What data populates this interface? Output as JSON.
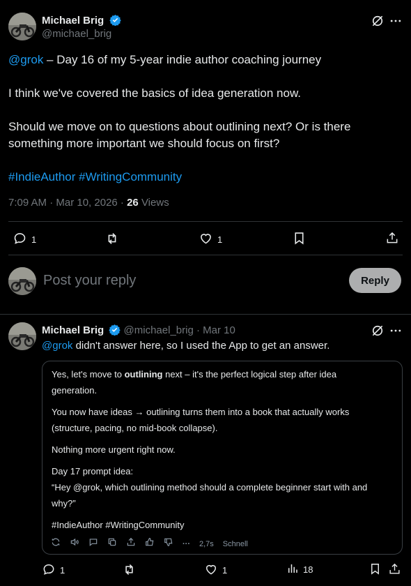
{
  "main_post": {
    "author_name": "Michael Brig",
    "author_handle": "@michael_brig",
    "text_mention": "@grok",
    "text_line1_rest": " – Day 16 of my 5-year indie author coaching journey",
    "text_line2": "I think we've covered the basics of idea generation now.",
    "text_line3a": "Should we move on to questions about outlining next? Or is there",
    "text_line3b": "something more important we should focus on first?",
    "hashtags": "#IndieAuthor #WritingCommunity",
    "timestamp": "7:09 AM · Mar 10, 2026 · ",
    "views_count": "26",
    "views_label": " Views",
    "reply_count": "1",
    "like_count": "1"
  },
  "composer": {
    "placeholder": "Post your reply",
    "reply_label": "Reply"
  },
  "reply_post": {
    "author_name": "Michael Brig",
    "author_handle": "@michael_brig",
    "dot": "·",
    "date": "Mar 10",
    "mention": "@grok",
    "text_rest": " didn't answer here, so I used the App to get an answer.",
    "reply_count": "1",
    "like_count": "1",
    "views_count": "18"
  },
  "grok_card": {
    "p1_pre": "Yes, let's move to ",
    "p1_bold": "outlining",
    "p1_post": " next – it's the perfect logical step after idea",
    "p1_line2": "generation.",
    "p2_line1": "You now have ideas → outlining turns them into a book that actually works",
    "p2_line2": "(structure, pacing, no mid-book collapse).",
    "p3": "Nothing more urgent right now.",
    "p4_line1": "Day 17 prompt idea:",
    "p4_line2": "“Hey @grok, which outlining method should a complete beginner start with and",
    "p4_line3": "why?”",
    "p5": "#IndieAuthor #WritingCommunity",
    "ellipsis": "···",
    "time": "2,7s",
    "mode": "Schnell"
  },
  "colors": {
    "link": "#1d9bf0",
    "muted": "#71767b",
    "background": "#000000",
    "divider": "#2f3336"
  },
  "icons": [
    "verified-badge-icon",
    "grok-icon",
    "more-icon",
    "reply-icon",
    "repost-icon",
    "like-icon",
    "bookmark-icon",
    "share-icon",
    "views-icon",
    "regenerate-icon",
    "speaker-icon",
    "comment-icon",
    "copy-icon",
    "export-icon",
    "thumbs-up-icon",
    "thumbs-down-icon"
  ]
}
